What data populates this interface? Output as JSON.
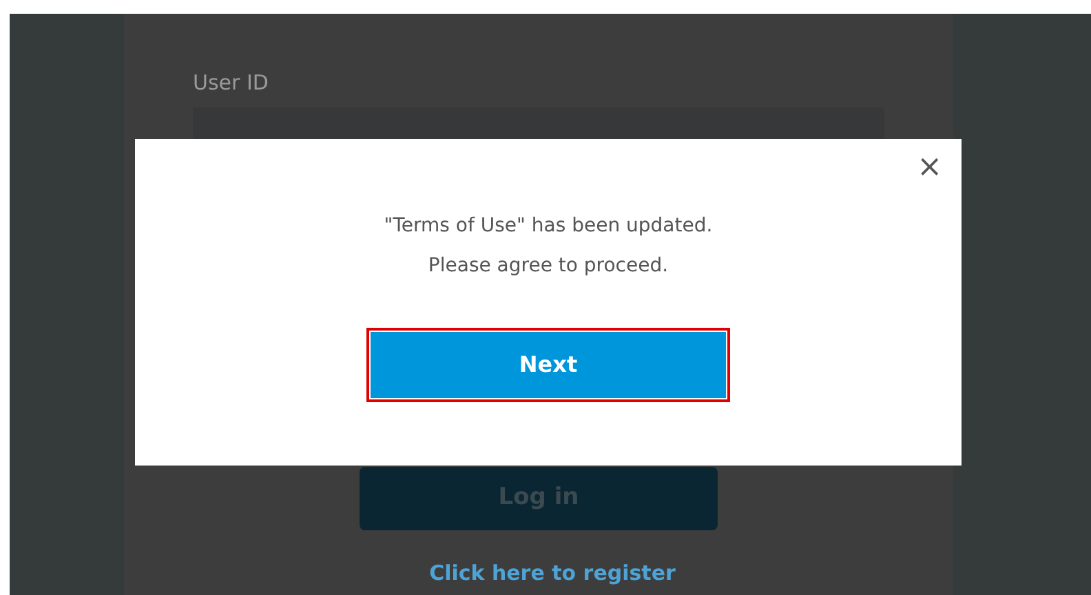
{
  "login_form": {
    "user_id_label": "User ID",
    "login_button": "Log in",
    "register_link": "Click here to register"
  },
  "dialog": {
    "close": "×",
    "message_lines": [
      "\"Terms of Use\" has been updated.",
      "Please agree to proceed."
    ],
    "next_button": {
      "label": "Next",
      "highlighted": true
    }
  }
}
